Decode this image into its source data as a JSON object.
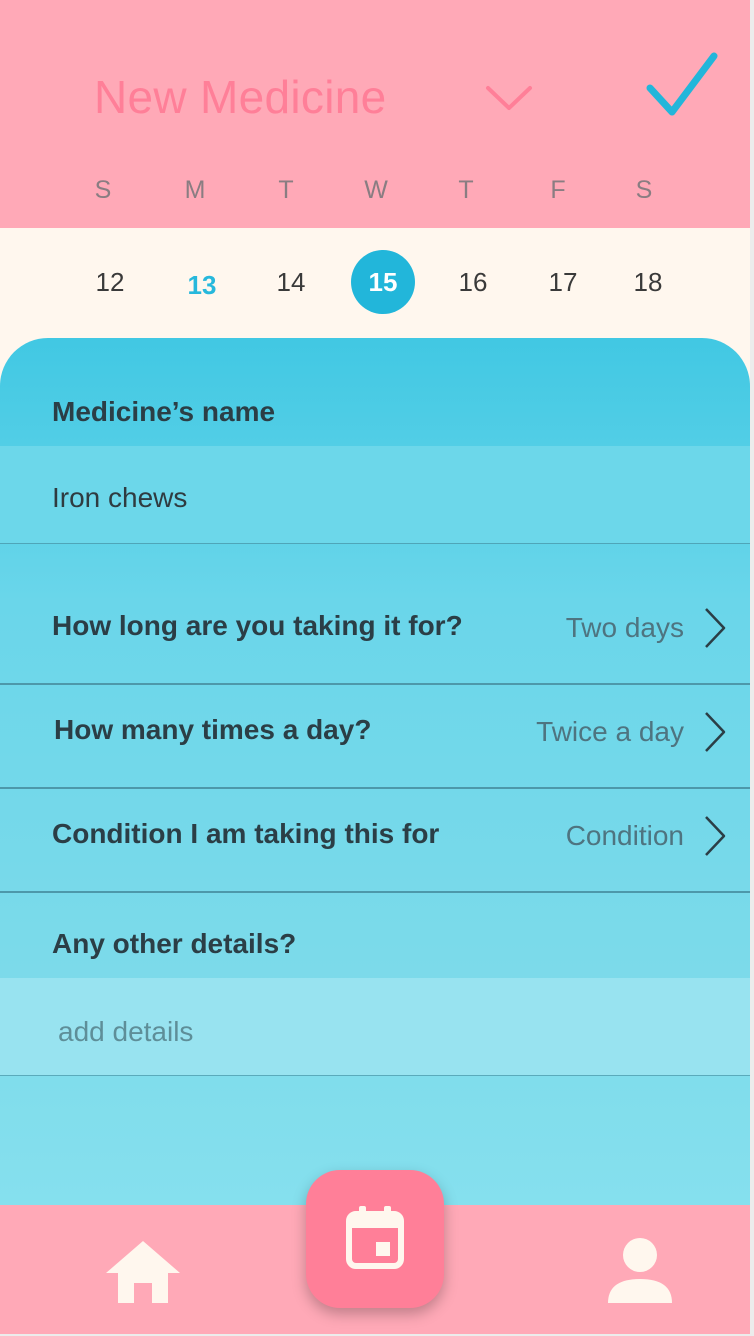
{
  "header": {
    "title": "New Medicine",
    "colors": {
      "background": "#ffa9b7",
      "title": "#ff7f98",
      "accent": "#22b6da"
    },
    "icons": {
      "dropdown": "chevron-down-icon",
      "confirm": "checkmark-icon"
    }
  },
  "calendar": {
    "weekdays": [
      "S",
      "M",
      "T",
      "W",
      "T",
      "F",
      "S"
    ],
    "dates": [
      "12",
      "13",
      "14",
      "15",
      "16",
      "17",
      "18"
    ],
    "today": "13",
    "selected": "15"
  },
  "form": {
    "name_label": "Medicine’s name",
    "name_value": "Iron chews",
    "duration": {
      "question": "How long are you taking it for?",
      "value": "Two days"
    },
    "frequency": {
      "question": "How many times a day?",
      "value": "Twice a day"
    },
    "condition": {
      "question": "Condition I am taking this for",
      "value": "Condition"
    },
    "details_label": "Any other details?",
    "details_placeholder": "add details"
  },
  "nav": {
    "items": [
      "home-icon",
      "calendar-icon",
      "profile-icon"
    ],
    "active": "calendar-icon"
  }
}
